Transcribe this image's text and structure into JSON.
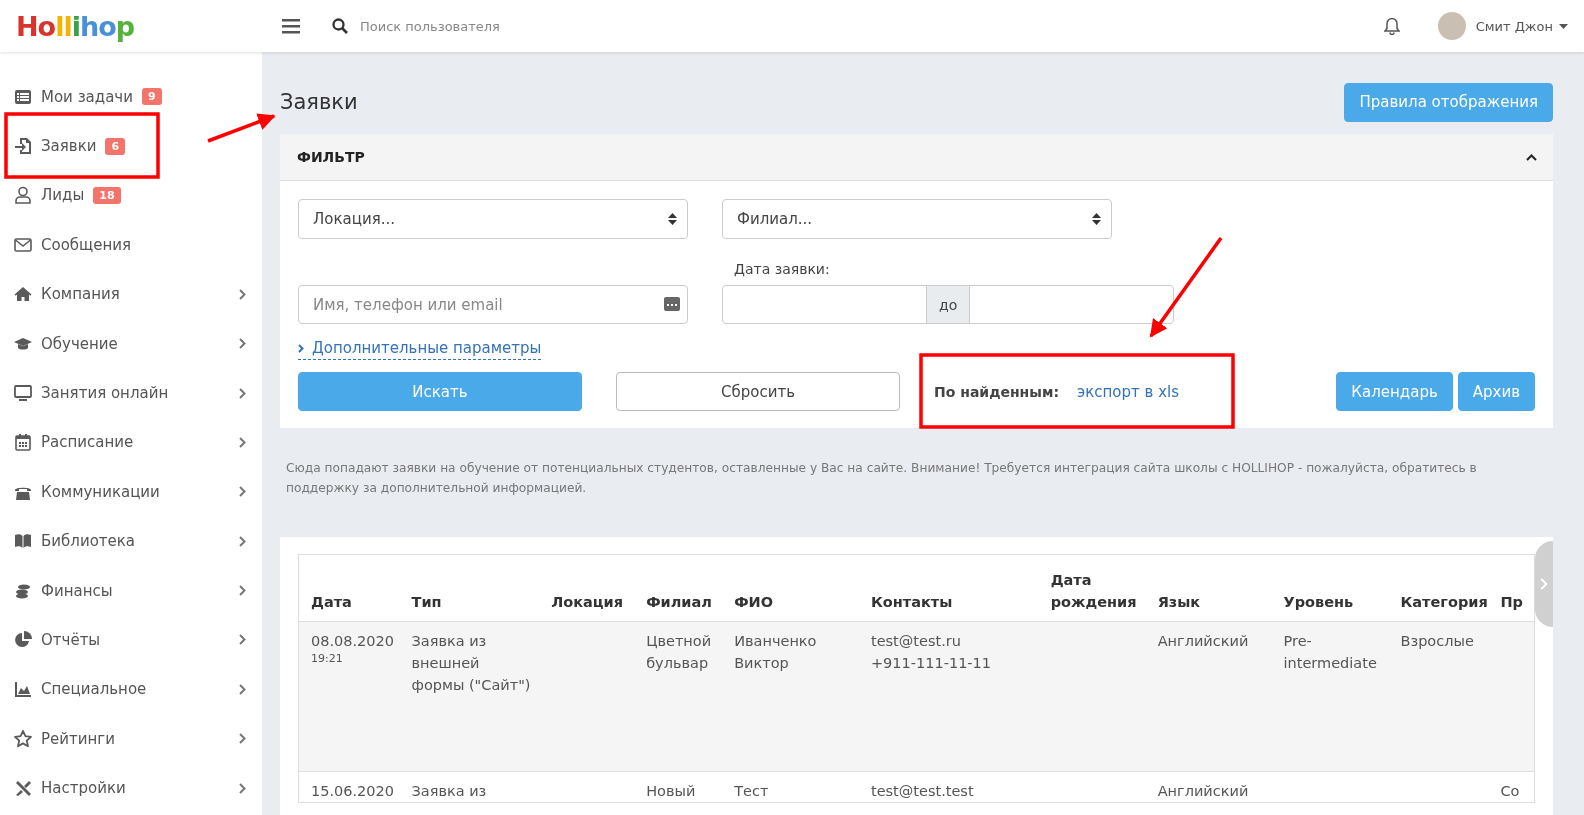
{
  "header": {
    "logo": "Hollihop",
    "search": {
      "placeholder": "Поиск пользователя"
    },
    "user": {
      "name": "Смит Джон"
    }
  },
  "sidebar": {
    "items": [
      {
        "label": "Мои задачи",
        "badge": "9",
        "has_submenu": false
      },
      {
        "label": "Заявки",
        "badge": "6",
        "has_submenu": false
      },
      {
        "label": "Лиды",
        "badge": "18",
        "has_submenu": false
      },
      {
        "label": "Сообщения",
        "has_submenu": false
      },
      {
        "label": "Компания",
        "has_submenu": true
      },
      {
        "label": "Обучение",
        "has_submenu": true
      },
      {
        "label": "Занятия онлайн",
        "has_submenu": true
      },
      {
        "label": "Расписание",
        "has_submenu": true
      },
      {
        "label": "Коммуникации",
        "has_submenu": true
      },
      {
        "label": "Библиотека",
        "has_submenu": true
      },
      {
        "label": "Финансы",
        "has_submenu": true
      },
      {
        "label": "Отчёты",
        "has_submenu": true
      },
      {
        "label": "Специальное",
        "has_submenu": true
      },
      {
        "label": "Рейтинги",
        "has_submenu": true
      },
      {
        "label": "Настройки",
        "has_submenu": true
      }
    ]
  },
  "page": {
    "title": "Заявки",
    "rules_button": "Правила отображения"
  },
  "filter": {
    "title": "ФИЛЬТР",
    "expanded": true,
    "location_select": {
      "placeholder": "Локация..."
    },
    "branch_select": {
      "placeholder": "Филиал..."
    },
    "search_field": {
      "placeholder": "Имя, телефон или email"
    },
    "date_label": "Дата заявки:",
    "date_separator": "до",
    "more_link": "Дополнительные параметры",
    "search_button": "Искать",
    "reset_button": "Сбросить",
    "export_label": "По найденным:",
    "export_link": "экспорт в xls",
    "calendar_button": "Календарь",
    "archive_button": "Архив"
  },
  "note": "Сюда попадают заявки на обучение от потенциальных студентов, оставленные у Вас на сайте. Внимание! Требуется интеграция сайта школы с HOLLIHOP - пожалуйста, обратитесь в поддержку за дополнительной информацией.",
  "table": {
    "columns": [
      "Дата",
      "Тип",
      "Локация",
      "Филиал",
      "ФИО",
      "Контакты",
      "Дата рождения",
      "Язык",
      "Уровень",
      "Категория",
      "Пр"
    ],
    "rows": [
      {
        "selected": true,
        "cells": [
          [
            "08.08.2020",
            "19:21"
          ],
          [
            "Заявка из внешней формы (\"Сайт\")"
          ],
          null,
          [
            "Цветной бульвар"
          ],
          [
            "Иванченко Виктор"
          ],
          [
            "test@test.ru",
            "+911-111-11-11"
          ],
          null,
          [
            "Английский"
          ],
          [
            "Pre-intermediate"
          ],
          [
            "Взрослые"
          ],
          null
        ]
      },
      {
        "selected": false,
        "cells": [
          [
            "15.06.2020"
          ],
          [
            "Заявка из"
          ],
          null,
          [
            "Новый"
          ],
          [
            "Тест"
          ],
          [
            "test@test.test"
          ],
          null,
          [
            "Английский"
          ],
          null,
          null,
          [
            "Со"
          ]
        ]
      }
    ]
  }
}
